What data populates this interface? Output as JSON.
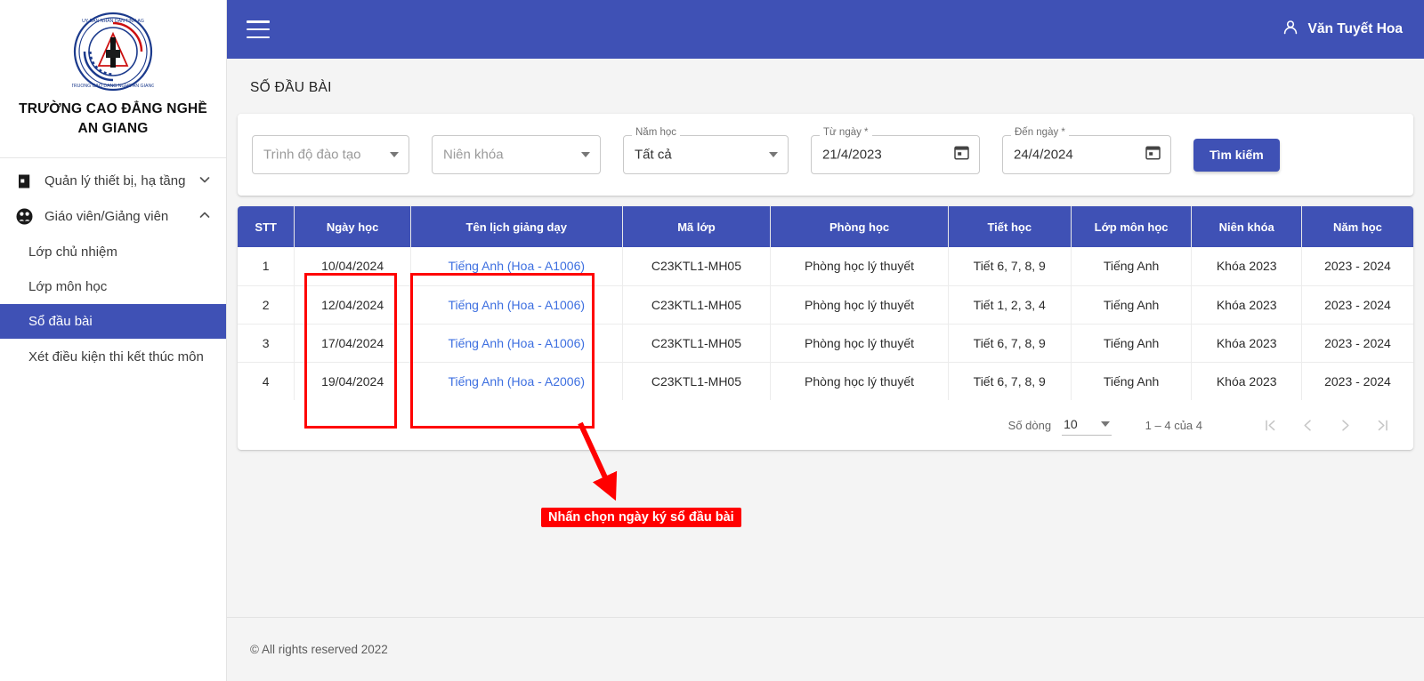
{
  "sidebar": {
    "school_name_line1": "TRƯỜNG CAO ĐẲNG NGHỀ",
    "school_name_line2": "AN GIANG",
    "logo_alt": "school-logo",
    "groups": [
      {
        "label": "Quản lý thiết bị, hạ tầng",
        "icon": "door-icon",
        "chevron": "chevron-down-icon",
        "expanded": false
      },
      {
        "label": "Giáo viên/Giảng viên",
        "icon": "people-group-icon",
        "chevron": "chevron-up-icon",
        "expanded": true
      }
    ],
    "sub_items": [
      {
        "label": "Lớp chủ nhiệm",
        "active": false
      },
      {
        "label": "Lớp môn học",
        "active": false
      },
      {
        "label": "Sổ đầu bài",
        "active": true
      },
      {
        "label": "Xét điều kiện thi kết thúc môn",
        "active": false
      }
    ]
  },
  "topbar": {
    "menu_icon": "hamburger-icon",
    "user_icon": "person-icon",
    "user_name": "Văn Tuyết Hoa"
  },
  "page": {
    "title": "SỐ ĐẦU BÀI"
  },
  "filters": {
    "trinh_do": {
      "legend": "",
      "placeholder": "Trình độ đào tạo",
      "value": ""
    },
    "nien_khoa": {
      "legend": "",
      "placeholder": "Niên khóa",
      "value": ""
    },
    "nam_hoc": {
      "legend": "Năm học",
      "placeholder": "",
      "value": "Tất cả"
    },
    "tu_ngay": {
      "legend": "Từ ngày *",
      "value": "21/4/2023",
      "icon": "calendar-icon"
    },
    "den_ngay": {
      "legend": "Đến ngày *",
      "value": "24/4/2024",
      "icon": "calendar-icon"
    },
    "search_button": "Tìm kiếm"
  },
  "table": {
    "columns": [
      "STT",
      "Ngày học",
      "Tên lịch giảng dạy",
      "Mã lớp",
      "Phòng học",
      "Tiết học",
      "Lớp môn học",
      "Niên khóa",
      "Năm học"
    ],
    "rows": [
      {
        "stt": "1",
        "ngay_hoc": "10/04/2024",
        "ten_lich": "Tiếng Anh (Hoa - A1006)",
        "ma_lop": "C23KTL1-MH05",
        "phong_hoc": "Phòng học lý thuyết",
        "tiet_hoc": "Tiết 6, 7, 8, 9",
        "lop_mon_hoc": "Tiếng Anh",
        "nien_khoa": "Khóa 2023",
        "nam_hoc": "2023 - 2024"
      },
      {
        "stt": "2",
        "ngay_hoc": "12/04/2024",
        "ten_lich": "Tiếng Anh (Hoa - A1006)",
        "ma_lop": "C23KTL1-MH05",
        "phong_hoc": "Phòng học lý thuyết",
        "tiet_hoc": "Tiết 1, 2, 3, 4",
        "lop_mon_hoc": "Tiếng Anh",
        "nien_khoa": "Khóa 2023",
        "nam_hoc": "2023 - 2024"
      },
      {
        "stt": "3",
        "ngay_hoc": "17/04/2024",
        "ten_lich": "Tiếng Anh (Hoa - A1006)",
        "ma_lop": "C23KTL1-MH05",
        "phong_hoc": "Phòng học lý thuyết",
        "tiet_hoc": "Tiết 6, 7, 8, 9",
        "lop_mon_hoc": "Tiếng Anh",
        "nien_khoa": "Khóa 2023",
        "nam_hoc": "2023 - 2024"
      },
      {
        "stt": "4",
        "ngay_hoc": "19/04/2024",
        "ten_lich": "Tiếng Anh (Hoa - A2006)",
        "ma_lop": "C23KTL1-MH05",
        "phong_hoc": "Phòng học lý thuyết",
        "tiet_hoc": "Tiết 6, 7, 8, 9",
        "lop_mon_hoc": "Tiếng Anh",
        "nien_khoa": "Khóa 2023",
        "nam_hoc": "2023 - 2024"
      }
    ]
  },
  "pagination": {
    "rows_label": "Số dòng",
    "rows_value": "10",
    "range": "1 – 4 của 4",
    "first_icon": "first-page-icon",
    "prev_icon": "previous-page-icon",
    "next_icon": "next-page-icon",
    "last_icon": "last-page-icon"
  },
  "annotation": {
    "label": "Nhấn chọn ngày ký sổ đầu bài",
    "color": "#ff0000"
  },
  "footer": {
    "text": "© All rights reserved 2022"
  },
  "colors": {
    "primary": "#3f51b5",
    "link": "#3d6fe0",
    "page_bg": "#f4f4f4",
    "annotation": "#ff0000"
  }
}
